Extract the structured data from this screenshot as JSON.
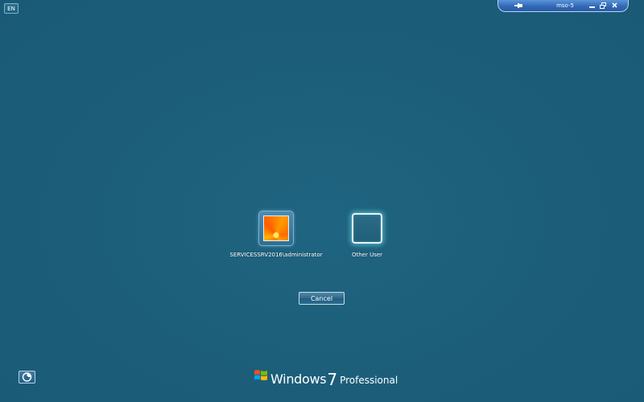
{
  "language_indicator": "EN",
  "rdp_bar": {
    "title": "mso-5",
    "pin_icon": "pin-icon",
    "minimize_icon": "minimize-icon",
    "restore_icon": "restore-icon",
    "close_icon": "close-icon"
  },
  "users": [
    {
      "label": "SERVICESSRV2016\\administrator",
      "avatar": "flower-avatar-picture"
    },
    {
      "label": "Other User",
      "avatar": "blank-avatar-frame"
    }
  ],
  "cancel_label": "Cancel",
  "ease_of_access_icon": "ease-of-access-icon",
  "branding": {
    "windows": "Windows",
    "version": "7",
    "edition": "Professional",
    "logo_icon": "windows-flag-icon"
  }
}
